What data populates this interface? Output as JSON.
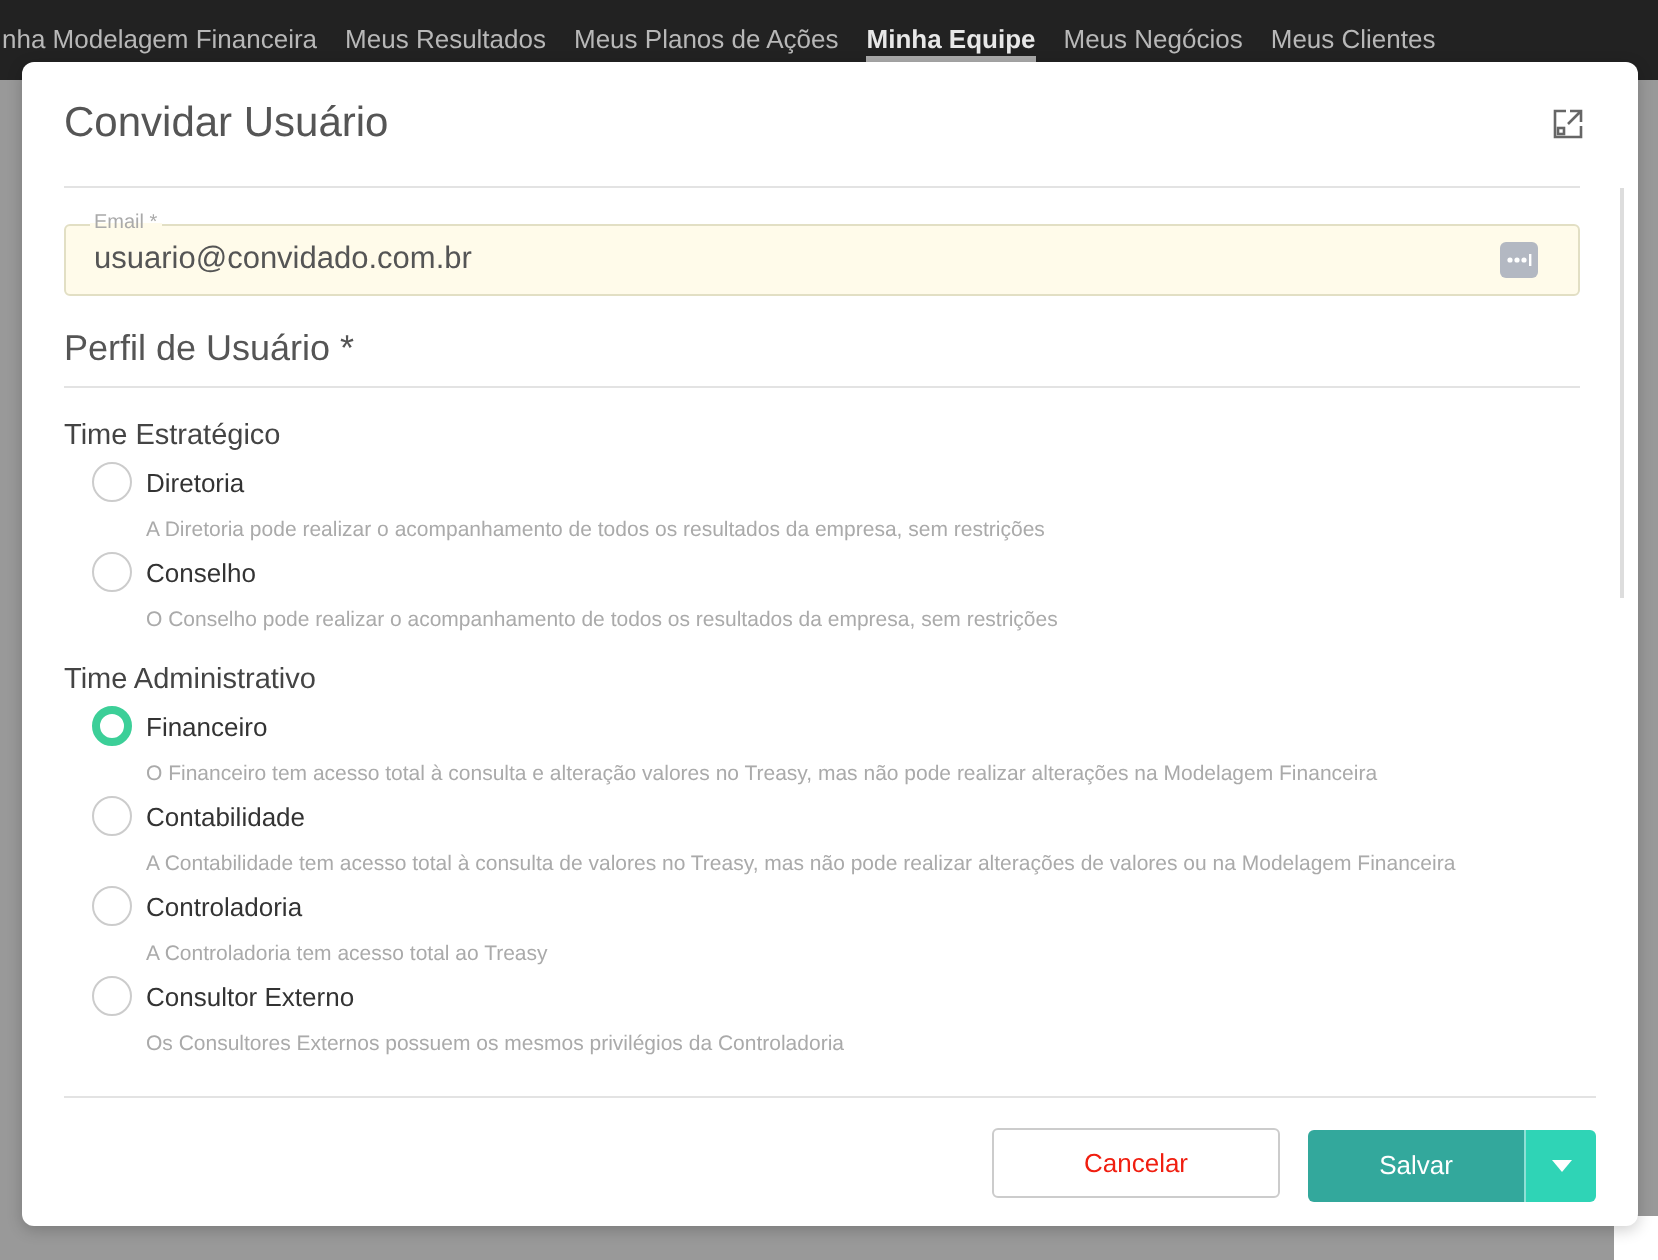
{
  "nav": [
    {
      "label": "nha Modelagem Financeira",
      "selected": false
    },
    {
      "label": "Meus Resultados",
      "selected": false
    },
    {
      "label": "Meus Planos de Ações",
      "selected": false
    },
    {
      "label": "Minha Equipe",
      "selected": true
    },
    {
      "label": "Meus Negócios",
      "selected": false
    },
    {
      "label": "Meus Clientes",
      "selected": false
    }
  ],
  "modal": {
    "title": "Convidar Usuário",
    "email": {
      "label": "Email *",
      "value": "usuario@convidado.com.br"
    },
    "section_title": "Perfil de Usuário *",
    "groups": [
      {
        "title": "Time Estratégico",
        "options": [
          {
            "label": "Diretoria",
            "description": "A Diretoria pode realizar o acompanhamento de todos os resultados da empresa, sem restrições",
            "selected": false
          },
          {
            "label": "Conselho",
            "description": "O Conselho pode realizar o acompanhamento de todos os resultados da empresa, sem restrições",
            "selected": false
          }
        ]
      },
      {
        "title": "Time Administrativo",
        "options": [
          {
            "label": "Financeiro",
            "description": "O Financeiro tem acesso total à consulta e alteração valores no Treasy, mas não pode realizar alterações na Modelagem Financeira",
            "selected": true
          },
          {
            "label": "Contabilidade",
            "description": "A Contabilidade tem acesso total à consulta de valores no Treasy, mas não pode realizar alterações de valores ou na Modelagem Financeira",
            "selected": false
          },
          {
            "label": "Controladoria",
            "description": "A Controladoria tem acesso total ao Treasy",
            "selected": false
          },
          {
            "label": "Consultor Externo",
            "description": "Os Consultores Externos possuem os mesmos privilégios da Controladoria",
            "selected": false
          }
        ]
      }
    ],
    "cancel": "Cancelar",
    "save": "Salvar"
  }
}
